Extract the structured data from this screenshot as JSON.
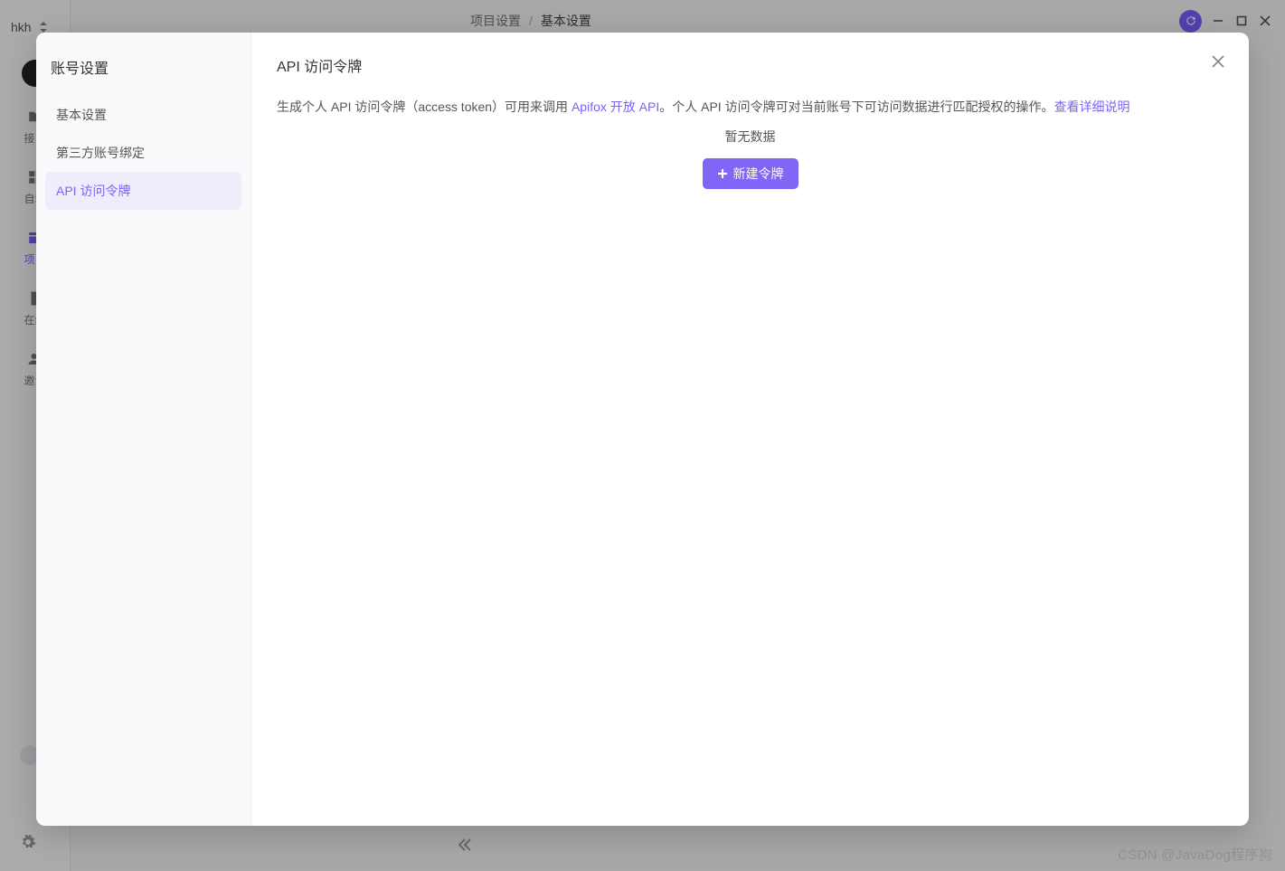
{
  "colors": {
    "accent": "#7b61ff"
  },
  "topbar": {
    "breadcrumb": {
      "root": "项目设置",
      "sep": "/",
      "current": "基本设置"
    }
  },
  "sidebar": {
    "project_name": "hkh",
    "items": [
      {
        "label": "接口"
      },
      {
        "label": "自动"
      },
      {
        "label": "项目"
      },
      {
        "label": "在线"
      },
      {
        "label": "邀请"
      }
    ]
  },
  "modal": {
    "side_title": "账号设置",
    "side_items": [
      {
        "label": "基本设置",
        "active": false
      },
      {
        "label": "第三方账号绑定",
        "active": false
      },
      {
        "label": "API 访问令牌",
        "active": true
      }
    ],
    "title": "API 访问令牌",
    "desc_part1": "生成个人 API 访问令牌（access token）可用来调用 ",
    "desc_link1": "Apifox 开放 API",
    "desc_part2": "。个人 API 访问令牌可对当前账号下可访问数据进行匹配授权的操作。",
    "desc_link2": "查看详细说明",
    "empty_text": "暂无数据",
    "create_btn_label": "新建令牌"
  },
  "watermark": "CSDN @JavaDog程序狗"
}
